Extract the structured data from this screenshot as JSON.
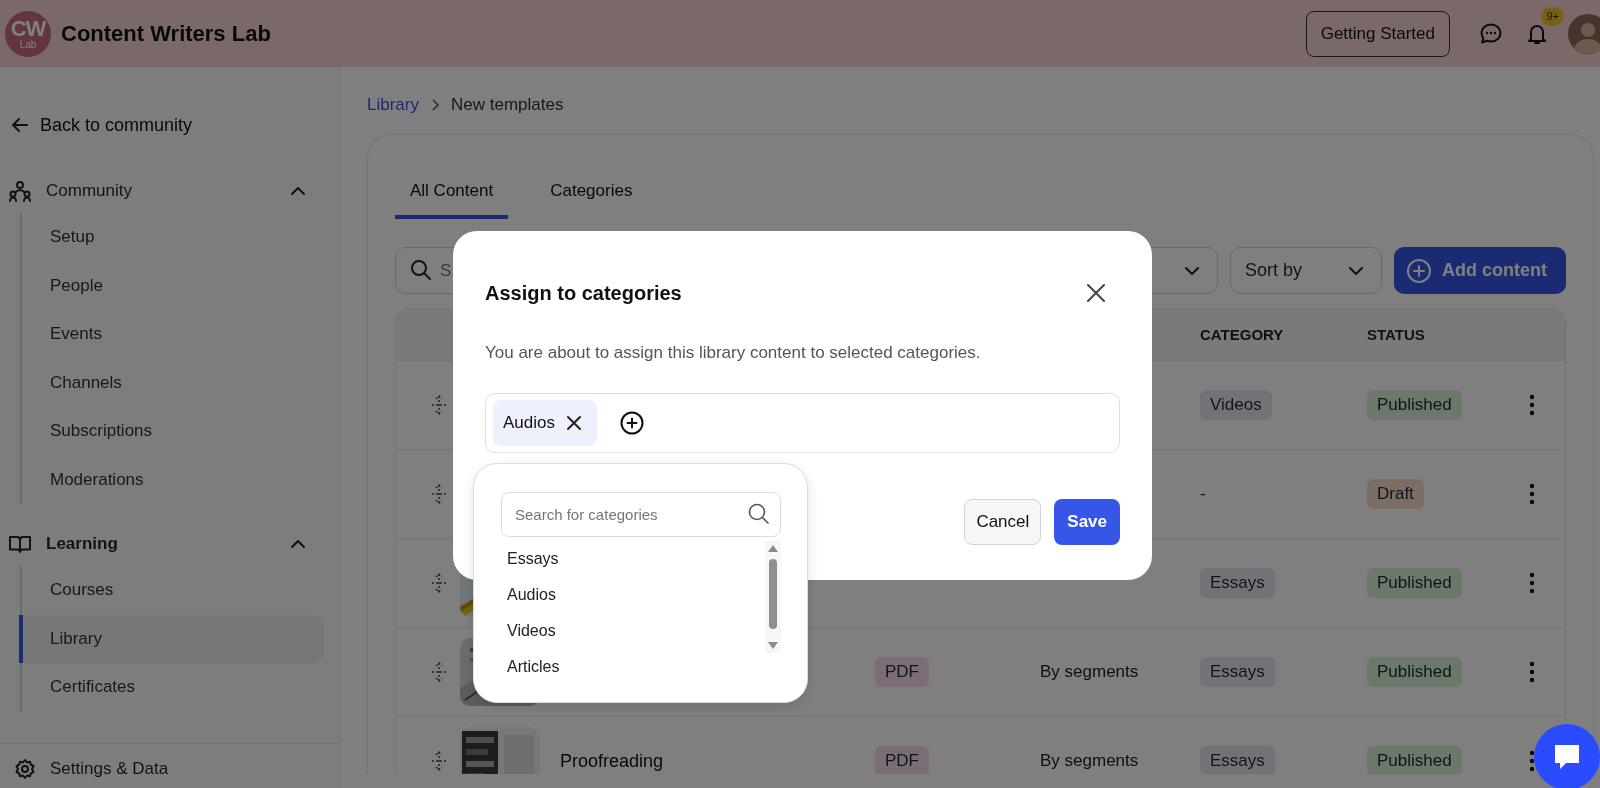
{
  "header": {
    "logo": {
      "initials": "CW",
      "caption": "Lab"
    },
    "title": "Content Writers Lab",
    "getting_started": "Getting Started",
    "notification_badge": "9+"
  },
  "sidebar": {
    "back": "Back to community",
    "sections": [
      {
        "label": "Community",
        "kind": "community",
        "expanded": true,
        "children": [
          {
            "label": "Setup",
            "selected": false
          },
          {
            "label": "People",
            "selected": false
          },
          {
            "label": "Events",
            "selected": false
          },
          {
            "label": "Channels",
            "selected": false
          },
          {
            "label": "Subscriptions",
            "selected": false
          },
          {
            "label": "Moderations",
            "selected": false
          }
        ]
      },
      {
        "label": "Learning",
        "kind": "learning",
        "expanded": true,
        "children": [
          {
            "label": "Courses",
            "selected": false
          },
          {
            "label": "Library",
            "selected": true
          },
          {
            "label": "Certificates",
            "selected": false
          }
        ]
      }
    ],
    "footer": "Settings & Data"
  },
  "breadcrumb": [
    {
      "label": "Library",
      "kind": "link"
    },
    {
      "label": "New templates",
      "kind": "current"
    }
  ],
  "tabs": [
    {
      "label": "All Content",
      "selected": true
    },
    {
      "label": "Categories",
      "selected": false
    }
  ],
  "toolbar": {
    "search": {
      "placeholder": "S"
    },
    "sort": {
      "label": "Sort by"
    },
    "add_button": "Add content"
  },
  "table": {
    "columns": {
      "category": "CATEGORY",
      "status": "STATUS"
    },
    "rows": [
      {
        "category": {
          "label": "Videos",
          "kind": "tag"
        },
        "status": {
          "label": "Published",
          "kind": "published"
        }
      },
      {
        "category": {
          "label": "-",
          "kind": "none"
        },
        "status": {
          "label": "Draft",
          "kind": "draft"
        }
      },
      {
        "category": {
          "label": "Essays",
          "kind": "tag"
        },
        "status": {
          "label": "Published",
          "kind": "published"
        }
      },
      {
        "type": "PDF",
        "access": "By segments",
        "category": {
          "label": "Essays",
          "kind": "tag"
        },
        "status": {
          "label": "Published",
          "kind": "published"
        }
      },
      {
        "title": "Proofreading",
        "type": "PDF",
        "access": "By segments",
        "category": {
          "label": "Essays",
          "kind": "tag"
        },
        "status": {
          "label": "Published",
          "kind": "published"
        }
      }
    ]
  },
  "modal": {
    "title": "Assign to categories",
    "description": "You are about to assign this library content to selected categories.",
    "tags": [
      {
        "label": "Audios"
      }
    ],
    "cancel": "Cancel",
    "save": "Save"
  },
  "category_picker": {
    "search": {
      "placeholder": "Search for categories"
    },
    "options": [
      {
        "label": "Essays",
        "selected": false
      },
      {
        "label": "Audios",
        "selected": false
      },
      {
        "label": "Videos",
        "selected": false
      },
      {
        "label": "Articles",
        "selected": false
      }
    ]
  }
}
